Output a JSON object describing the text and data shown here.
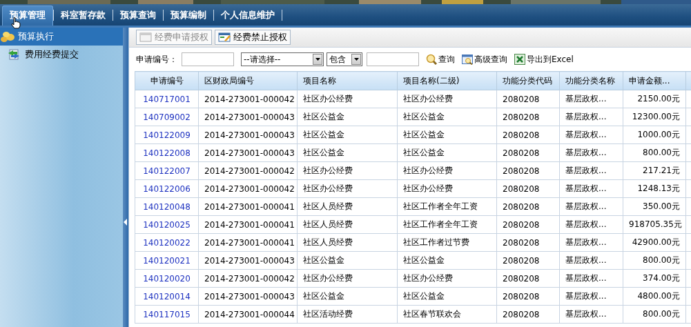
{
  "nav_tabs": [
    {
      "label": "预算管理",
      "selected": true
    },
    {
      "label": "科室暂存款",
      "selected": false
    },
    {
      "label": "预算查询",
      "selected": false
    },
    {
      "label": "预算编制",
      "selected": false
    },
    {
      "label": "个人信息维护",
      "selected": false
    }
  ],
  "sidebar": {
    "items": [
      {
        "label": "预算执行",
        "kind": "group",
        "selected": true
      },
      {
        "label": "费用经费提交",
        "kind": "link",
        "selected": false
      }
    ]
  },
  "toolbar": [
    {
      "label": "经费申请授权",
      "disabled": true
    },
    {
      "label": "经费禁止授权",
      "disabled": false
    }
  ],
  "search": {
    "label": "申请编号：",
    "select": "--请选择--",
    "match": "包含",
    "actions": [
      {
        "label": "查询",
        "kind": "search"
      },
      {
        "label": "高级查询",
        "kind": "advanced"
      },
      {
        "label": "导出到Excel",
        "kind": "excel"
      }
    ]
  },
  "table": {
    "columns": [
      "申请编号",
      "区财政局编号",
      "项目名称",
      "项目名称(二级)",
      "功能分类代码",
      "功能分类名称",
      "申请金额..."
    ],
    "rows": [
      [
        "140717001",
        "2014-273001-000042",
        "社区办公经费",
        "社区办公经费",
        "2080208",
        "基层政权...",
        "2150.00元"
      ],
      [
        "140709002",
        "2014-273001-000043",
        "社区公益金",
        "社区公益金",
        "2080208",
        "基层政权...",
        "12300.00元"
      ],
      [
        "140122009",
        "2014-273001-000043",
        "社区公益金",
        "社区公益金",
        "2080208",
        "基层政权...",
        "1000.00元"
      ],
      [
        "140122008",
        "2014-273001-000043",
        "社区公益金",
        "社区公益金",
        "2080208",
        "基层政权...",
        "800.00元"
      ],
      [
        "140122007",
        "2014-273001-000042",
        "社区办公经费",
        "社区办公经费",
        "2080208",
        "基层政权...",
        "217.21元"
      ],
      [
        "140122006",
        "2014-273001-000042",
        "社区办公经费",
        "社区办公经费",
        "2080208",
        "基层政权...",
        "1248.13元"
      ],
      [
        "140120048",
        "2014-273001-000041",
        "社区人员经费",
        "社区工作者全年工资",
        "2080208",
        "基层政权...",
        "350.00元"
      ],
      [
        "140120025",
        "2014-273001-000041",
        "社区人员经费",
        "社区工作者全年工资",
        "2080208",
        "基层政权...",
        "918705.35元"
      ],
      [
        "140120022",
        "2014-273001-000041",
        "社区人员经费",
        "社区工作者过节费",
        "2080208",
        "基层政权...",
        "42900.00元"
      ],
      [
        "140120021",
        "2014-273001-000043",
        "社区公益金",
        "社区公益金",
        "2080208",
        "基层政权...",
        "800.00元"
      ],
      [
        "140120020",
        "2014-273001-000042",
        "社区办公经费",
        "社区办公经费",
        "2080208",
        "基层政权...",
        "374.00元"
      ],
      [
        "140120014",
        "2014-273001-000043",
        "社区公益金",
        "社区公益金",
        "2080208",
        "基层政权...",
        "4800.00元"
      ],
      [
        "140117015",
        "2014-273001-000044",
        "社区活动经费",
        "社区春节联欢会",
        "2080208",
        "基层政权...",
        "800.00元"
      ]
    ]
  }
}
